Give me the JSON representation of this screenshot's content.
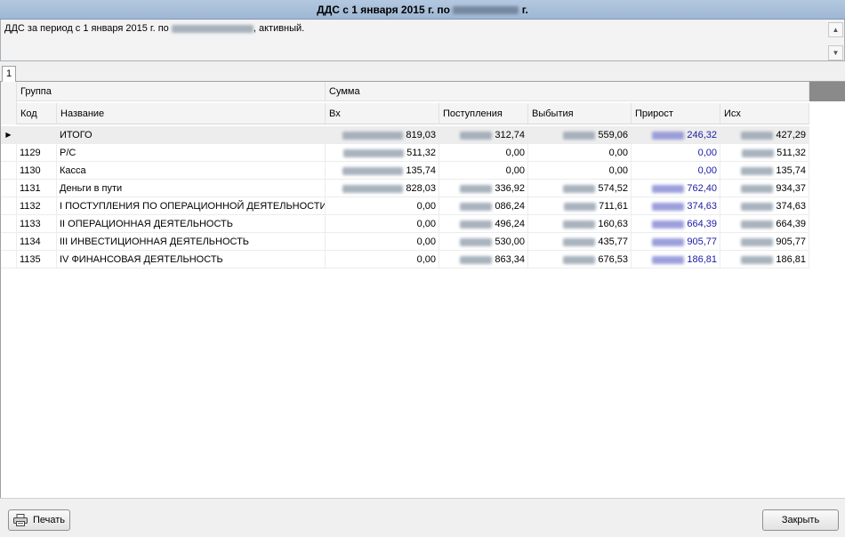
{
  "window": {
    "title_prefix": "ДДС с 1 января 2015 г. по",
    "title_suffix": "г."
  },
  "memo": {
    "text_prefix": "ДДС за период с 1 января 2015 г. по",
    "text_suffix": ", активный."
  },
  "tabs": [
    {
      "label": "1"
    }
  ],
  "grid": {
    "group_headers": {
      "group": "Группа",
      "sum": "Сумма"
    },
    "columns": {
      "code": "Код",
      "name": "Название",
      "in": "Вх",
      "receipts": "Поступления",
      "disposals": "Выбытия",
      "growth": "Прирост",
      "out": "Исх"
    },
    "rows": [
      {
        "code": "",
        "name": "ИТОГО",
        "in": "819,03",
        "receipts": "312,74",
        "disposals": "559,06",
        "growth": "246,32",
        "out": "427,29"
      },
      {
        "code": "1129",
        "name": "Р/С",
        "in": "511,32",
        "receipts": "0,00",
        "disposals": "0,00",
        "growth": "0,00",
        "out": "511,32"
      },
      {
        "code": "1130",
        "name": "Касса",
        "in": "135,74",
        "receipts": "0,00",
        "disposals": "0,00",
        "growth": "0,00",
        "out": "135,74"
      },
      {
        "code": "1131",
        "name": "Деньги в пути",
        "in": "828,03",
        "receipts": "336,92",
        "disposals": "574,52",
        "growth": "762,40",
        "out": "934,37"
      },
      {
        "code": "1132",
        "name": "I ПОСТУПЛЕНИЯ ПО ОПЕРАЦИОННОЙ ДЕЯТЕЛЬНОСТИ",
        "in": "0,00",
        "receipts": "086,24",
        "disposals": "711,61",
        "growth": "374,63",
        "out": "374,63"
      },
      {
        "code": "1133",
        "name": "II ОПЕРАЦИОННАЯ ДЕЯТЕЛЬНОСТЬ",
        "in": "0,00",
        "receipts": "496,24",
        "disposals": "160,63",
        "growth": "664,39",
        "out": "664,39"
      },
      {
        "code": "1134",
        "name": "III ИНВЕСТИЦИОННАЯ ДЕЯТЕЛЬНОСТЬ",
        "in": "0,00",
        "receipts": "530,00",
        "disposals": "435,77",
        "growth": "905,77",
        "out": "905,77"
      },
      {
        "code": "1135",
        "name": "IV ФИНАНСОВАЯ ДЕЯТЕЛЬНОСТЬ",
        "in": "0,00",
        "receipts": "863,34",
        "disposals": "676,53",
        "growth": "186,81",
        "out": "186,81"
      }
    ]
  },
  "footer": {
    "print_label": "Печать",
    "close_label": "Закрыть"
  },
  "icons": {
    "print": "printer-icon",
    "row_pointer": "row-pointer-icon"
  },
  "colors": {
    "growth_text": "#1a1aa6",
    "title_bar": "#a9c0dc",
    "total_row_bg": "#ededed"
  }
}
